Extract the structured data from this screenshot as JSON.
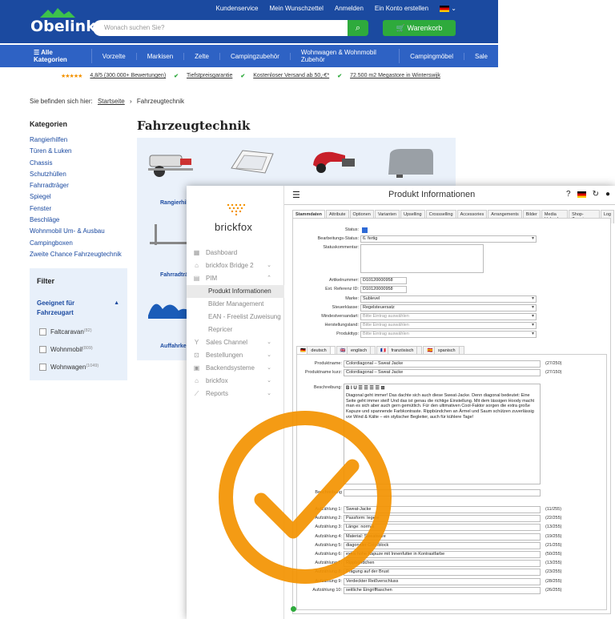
{
  "site": {
    "logo": "Obelink",
    "toplinks": [
      "Kundenservice",
      "Mein Wunschzettel",
      "Anmelden",
      "Ein Konto erstellen"
    ],
    "search_placeholder": "Wonach suchen Sie?",
    "cart": "Warenkorb",
    "nav": [
      "Alle Kategorien",
      "Vorzelte",
      "Markisen",
      "Zelte",
      "Campingzubehör",
      "Wohnwagen & Wohnmobil Zubehör",
      "Campingmöbel",
      "Sale"
    ],
    "usp": {
      "rating": "4,8/5 (300.000+ Bewertungen)",
      "u1": "Tiefstpreisgarantie",
      "u2": "Kostenloser Versand ab 50,-€*",
      "u3": "72.500 m2 Megastore in Winterswijk"
    },
    "breadcrumb": {
      "prefix": "Sie befinden sich hier:",
      "home": "Startseite",
      "sep": "›",
      "current": "Fahrzeugtechnik"
    },
    "categories_title": "Kategorien",
    "categories": [
      "Rangierhilfen",
      "Türen & Luken",
      "Chassis",
      "Schutzhüllen",
      "Fahrradträger",
      "Spiegel",
      "Fenster",
      "Beschläge",
      "Wohnmobil Um- & Ausbau",
      "Campingboxen",
      "Zweite Chance Fahrzeugtechnik"
    ],
    "page_title": "Fahrzeugtechnik",
    "products": [
      "Rangierhilf",
      "Fahrradträg",
      "Auffahrkei"
    ],
    "filter": {
      "title": "Filter",
      "group": "Geeignet für Fahrzeugart",
      "options": [
        {
          "label": "Faltcaravan",
          "count": "(82)"
        },
        {
          "label": "Wohnmobil",
          "count": "(809)"
        },
        {
          "label": "Wohnwagen",
          "count": "(1049)"
        }
      ]
    }
  },
  "bf": {
    "logo": "brickfox",
    "nav": [
      {
        "label": "Dashboard",
        "icon": "▦",
        "chev": ""
      },
      {
        "label": "brickfox Bridge 2",
        "icon": "⌂",
        "chev": "⌄"
      },
      {
        "label": "PIM",
        "icon": "▤",
        "chev": "⌃"
      }
    ],
    "pim_sub": [
      "Produkt Informationen",
      "Bilder Management",
      "EAN - Freelist Zuweisung",
      "Repricer"
    ],
    "nav2": [
      {
        "label": "Sales Channel",
        "icon": "Y",
        "chev": "⌄"
      },
      {
        "label": "Bestellungen",
        "icon": "⊡",
        "chev": "⌄"
      },
      {
        "label": "Backendsysteme",
        "icon": "▣",
        "chev": "⌄"
      },
      {
        "label": "brickfox",
        "icon": "⌂",
        "chev": "⌄"
      },
      {
        "label": "Reports",
        "icon": "⟋",
        "chev": "⌄"
      }
    ],
    "title": "Produkt Informationen",
    "tabs": [
      "Stammdaten",
      "Attribute",
      "Optionen",
      "Varianten",
      "Upselling",
      "Crossselling",
      "Accessories",
      "Arrangements",
      "Bilder",
      "Media Upload",
      "Shop-Zuweisung",
      "Log"
    ],
    "fields": {
      "status_lbl": "Status:",
      "bstatus_lbl": "Bearbeitungs-Status:",
      "bstatus": "6. fertig",
      "skomm_lbl": "Statuskommentar:",
      "artnr_lbl": "Artikelnummer:",
      "artnr": "D10120000958",
      "extref_lbl": "Ext. Referenz ID:",
      "extref": "D10120000958",
      "marke_lbl": "Marke:",
      "marke": "Sublevel",
      "steuer_lbl": "Steuerklasse:",
      "steuer": "Regelsteuersatz",
      "minv_lbl": "Mindestversandart:",
      "minv": "Bitte Eintrag auswählen",
      "herst_lbl": "Herstellungsland:",
      "herst": "Bitte Eintrag auswählen",
      "ptyp_lbl": "Produkttyp:",
      "ptyp": "Bitte Eintrag auswählen"
    },
    "langs": [
      "deutsch",
      "englisch",
      "französisch",
      "spanisch"
    ],
    "pname_lbl": "Produktname:",
    "pname": "Colordiagonal – Sweat Jacke",
    "pname_cnt": "(27/250)",
    "pshort_lbl": "Produktname kurz:",
    "pshort": "Colordiagonal – Sweat Jacke",
    "pshort_cnt": "(27/150)",
    "desc_lbl": "Beschreibung:",
    "desc_tb": "B  I  U  ☰ ☰  ☰ ☰  ⊞",
    "desc_text": "Diagonal geht immer! Das dachte sich auch diese Sweat-Jacke. Denn diagonal bedeutet: Eine Seite geht immer steil! Und das ist genau die richtige Einstellung. Mit dem lässigen Hoody macht man es sich aber auch gern gemütlich. Für den ultimativen Cool-Faktor sorgen die extra große Kapuze und spannende Farbkontraste. Rippbündchen an Ärmel und Saum schützen zuverlässig vor Wind & Kälte – ein stylischer Begleiter, auch für kühlere Tage!",
    "desc2_lbl": "Beschreibung",
    "bullets": [
      {
        "lbl": "Aufzählung 1:",
        "val": "Sweat-Jacke",
        "cnt": "(11/255)"
      },
      {
        "lbl": "Aufzählung 2:",
        "val": "Passform: legere",
        "cnt": "(22/255)"
      },
      {
        "lbl": "Aufzählung 3:",
        "val": "Länge: normal",
        "cnt": "(13/255)"
      },
      {
        "lbl": "Aufzählung 4:",
        "val": "Material: Sweatware",
        "cnt": "(19/255)"
      },
      {
        "lbl": "Aufzählung 5:",
        "val": "diagonaler Colorblock",
        "cnt": "(21/255)"
      },
      {
        "lbl": "Aufzählung 6:",
        "val": "extra hohe Kapuze mit Innenfutter in Kontrastfarbe",
        "cnt": "(50/255)"
      },
      {
        "lbl": "Aufzählung 7:",
        "val": "Rippbündchen",
        "cnt": "(13/255)"
      },
      {
        "lbl": "Aufzählung 8:",
        "val": "Prägung auf der Brust",
        "cnt": "(23/255)"
      },
      {
        "lbl": "Aufzählung 9:",
        "val": "Verdeckter Reißverschluss",
        "cnt": "(28/255)"
      },
      {
        "lbl": "Aufzählung 10:",
        "val": "seitliche Eingrifftaschen",
        "cnt": "(26/255)"
      }
    ]
  },
  "colors": {
    "obelink_blue": "#1b4aa0",
    "nav_blue": "#2e62c4",
    "green": "#2eaa3c",
    "orange": "#f39200"
  }
}
